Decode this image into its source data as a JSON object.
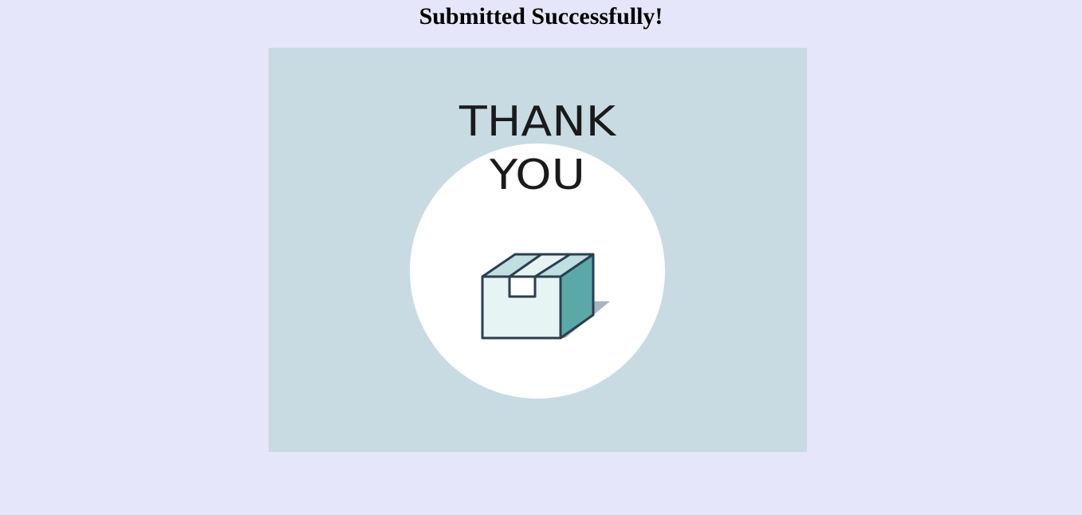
{
  "page": {
    "title": "Submitted Successfully!"
  },
  "thank_you_image": {
    "line1": "THANK",
    "line2": "YOU",
    "icon": "box-icon"
  },
  "colors": {
    "page_background": "#e6e6fa",
    "card_background": "#c8dbe3",
    "circle": "#ffffff",
    "box_outline": "#2c3e50",
    "box_front": "#e6f4f3",
    "box_top": "#bfdfe0",
    "box_side": "#5ba8a8",
    "box_shadow": "#a9b4bf"
  }
}
